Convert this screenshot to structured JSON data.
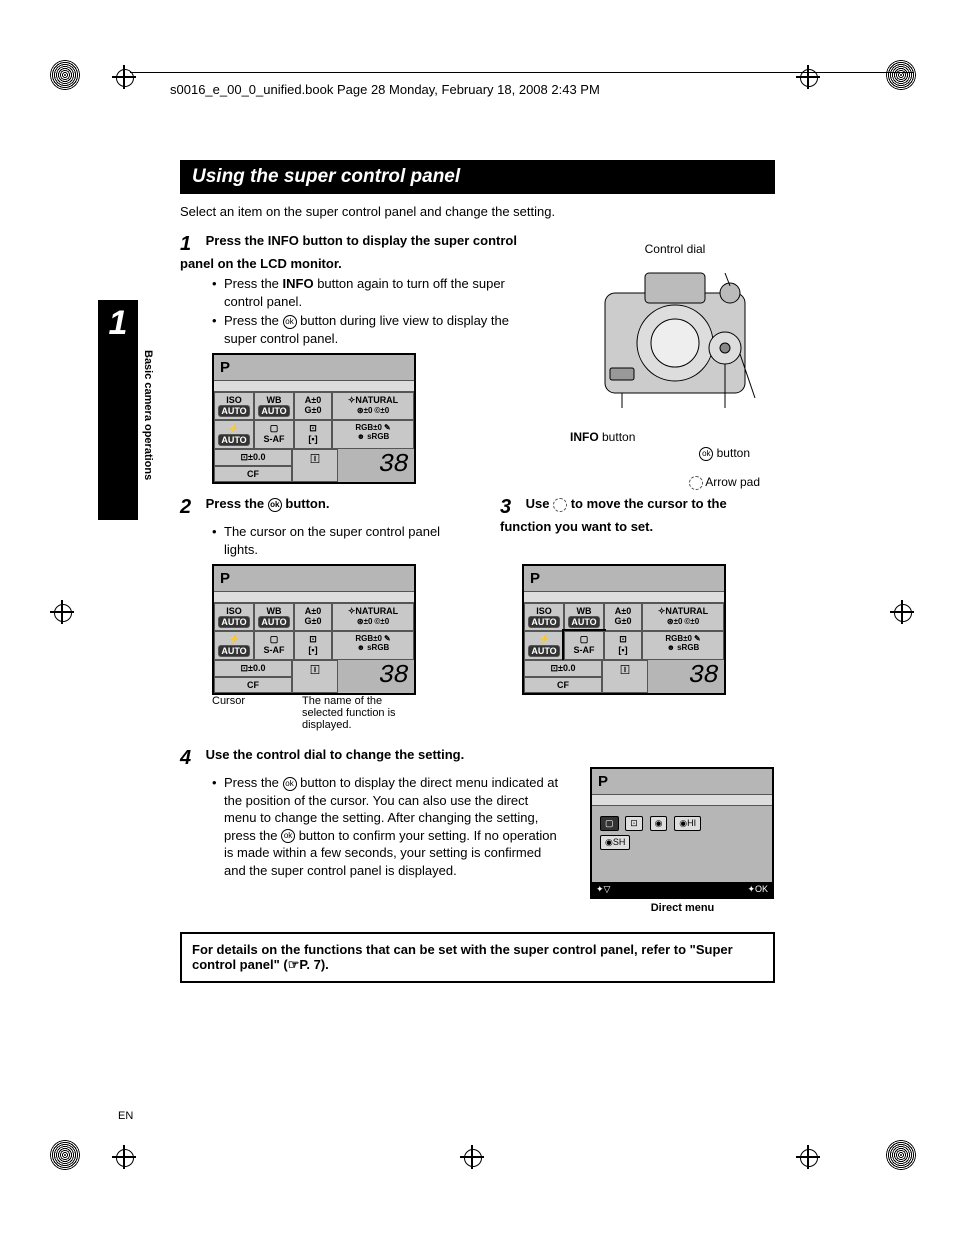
{
  "header": {
    "running": "s0016_e_00_0_unified.book  Page 28  Monday, February 18, 2008  2:43 PM"
  },
  "section": {
    "title": "Using the super control panel",
    "intro": "Select an item on the super control panel and change the setting."
  },
  "side": {
    "chapter_num": "1",
    "chapter_label": "Basic camera operations"
  },
  "camera": {
    "control_dial": "Control dial",
    "info_button": " button",
    "info_prefix": "INFO",
    "ok_button": " button",
    "arrow_pad": "Arrow pad"
  },
  "steps": {
    "s1": {
      "num": "1",
      "head_a": "Press the ",
      "head_b": "INFO",
      "head_c": " button to display the super control panel on the LCD monitor.",
      "b1a": "Press the ",
      "b1b": "INFO",
      "b1c": " button again to turn off the super control panel.",
      "b2a": "Press the ",
      "b2c": " button during live view to display the super control panel."
    },
    "s2": {
      "num": "2",
      "head_a": "Press the ",
      "head_c": " button.",
      "b1": "The cursor on the super control panel lights."
    },
    "s3": {
      "num": "3",
      "head_a": "Use ",
      "head_c": " to move the cursor to the function you want to set."
    },
    "s4": {
      "num": "4",
      "head": "Use the control dial to change the setting.",
      "b1a": "Press the ",
      "b1c": " button to display the direct menu indicated at the position of the cursor. You can also use the direct menu to change the setting. After changing the setting, press the ",
      "b1e": " button to confirm your setting. If no operation is made within a few seconds, your setting is confirmed and the super control panel is displayed."
    }
  },
  "lcd": {
    "mode": "P",
    "iso": "ISO",
    "auto": "AUTO",
    "wb": "WB",
    "a0": "A±0",
    "g0": "G±0",
    "natural": "NATURAL",
    "s0": "⊛±0",
    "c0": "©±0",
    "rgb0": "RGB±0",
    "pencil": "✎",
    "saf": "S-AF",
    "meter": "[▪]",
    "face": "☻",
    "srgb": "sRGB",
    "ev": "⊡±0.0",
    "cf": "CF",
    "is": "🄸",
    "frames": "38",
    "cursor_label": "Cursor",
    "func_label": "The name of the selected function is displayed."
  },
  "directmenu": {
    "opts": [
      "▢",
      "⊡",
      "◉",
      "◉HI",
      "◉SH"
    ],
    "foot_left": "✦▽",
    "foot_right": "✦OK",
    "caption": "Direct menu"
  },
  "refbox": {
    "text_a": "For details on the functions that can be set with the super control panel, refer to \"Super control panel\" (",
    "text_b": "P. 7).",
    "ref_icon": "☞"
  },
  "footer": {
    "lang": "EN"
  }
}
